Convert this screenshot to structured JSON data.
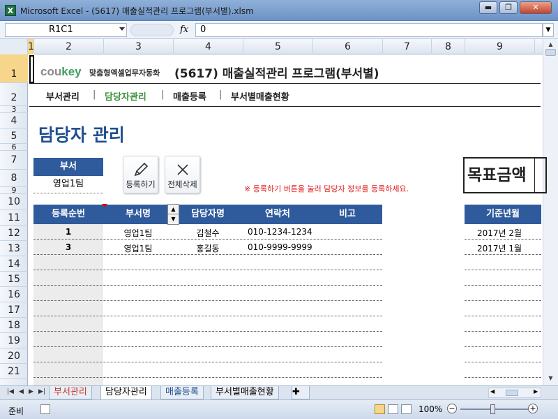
{
  "window": {
    "title": "Microsoft Excel - (5617) 매출실적관리 프로그램(부서별).xlsm",
    "app_icon": "X",
    "buttons": {
      "minimize": "▬",
      "restore": "❐",
      "close": "✕"
    }
  },
  "formula_bar": {
    "name_box": "R1C1",
    "fx": "fx",
    "value": "0"
  },
  "columns": [
    "1",
    "2",
    "3",
    "4",
    "5",
    "6",
    "7",
    "8",
    "9"
  ],
  "rows": [
    "1",
    "2",
    "3",
    "4",
    "5",
    "6",
    "7",
    "8",
    "9",
    "10",
    "11",
    "12",
    "13",
    "14",
    "15",
    "16",
    "17",
    "18",
    "19",
    "20",
    "21"
  ],
  "header": {
    "logo_main": "cou",
    "logo_accent": "key",
    "logo_sub": "맞춤형엑셀업무자동화",
    "title": "(5617) 매출실적관리 프로그램(부서별)"
  },
  "nav": {
    "items": [
      "부서관리",
      "담당자관리",
      "매출등록",
      "부서별매출현황"
    ],
    "separator": "|",
    "active_color": "#3a8f3a"
  },
  "page": {
    "heading": "담당자 관리",
    "dept_label": "부서",
    "dept_value": "영업1팀",
    "register_button": "등록하기",
    "delete_all_button": "전체삭제",
    "notice": "※ 등록하기 버튼을 눌러 담당자 정보를 등록하세요.",
    "target_label": "목표금액"
  },
  "table": {
    "headers": [
      "등록순번",
      "부서명",
      "담당자명",
      "연락처",
      "비고"
    ],
    "rows": [
      {
        "seq": "1",
        "dept": "영업1팀",
        "name": "김철수",
        "phone": "010-1234-1234",
        "note": ""
      },
      {
        "seq": "3",
        "dept": "영업1팀",
        "name": "홍길동",
        "phone": "010-9999-9999",
        "note": ""
      }
    ],
    "date_header": "기준년월",
    "dates": [
      "2017년 2월",
      "2017년 1월"
    ]
  },
  "sheet_tabs": [
    "부서관리",
    "담당자관리",
    "매출등록",
    "부서별매출현황"
  ],
  "active_tab": "담당자관리",
  "status": {
    "ready": "준비",
    "zoom": "100%"
  },
  "colors": {
    "accent_blue": "#2f5b9d",
    "heading_blue": "#1f4f8f",
    "notice_red": "#e01b1b",
    "logo_green": "#3e9e5f"
  }
}
